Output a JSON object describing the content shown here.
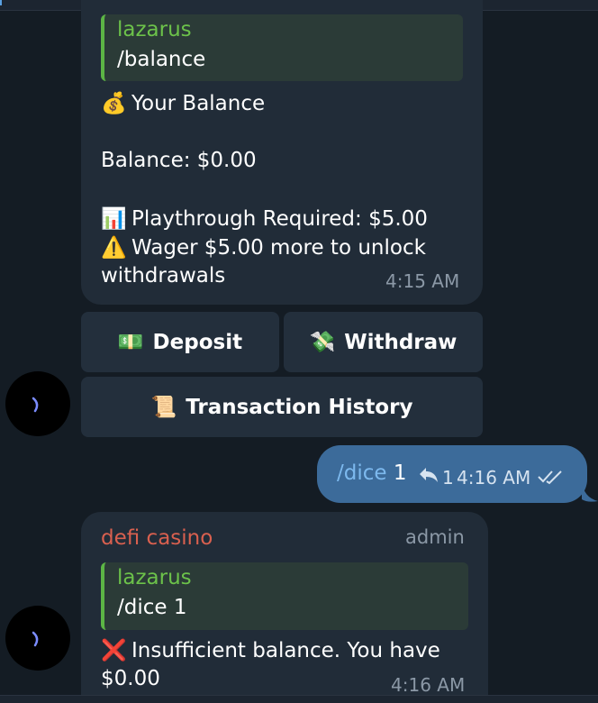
{
  "colors": {
    "background": "#141c24",
    "bubble_in": "#212c38",
    "bubble_out": "#3c6b9a",
    "reply_bar": "#5cb545",
    "sender_name": "#d9604f",
    "command_link": "#7db9ee"
  },
  "message1": {
    "reply": {
      "name": "lazarus",
      "text": "/balance"
    },
    "title_emoji": "💰",
    "title": "Your Balance",
    "balance_line": "Balance: $0.00",
    "playthrough_emoji": "📊",
    "playthrough": "Playthrough Required: $5.00",
    "warning_emoji": "⚠️",
    "warning": "Wager $5.00 more to unlock",
    "warning_cont": "withdrawals",
    "time": "4:15 AM"
  },
  "keyboard": {
    "deposit_icon": "💵",
    "deposit": "Deposit",
    "withdraw_icon": "💸",
    "withdraw": "Withdraw",
    "history_icon": "📜",
    "history": "Transaction History"
  },
  "outgoing": {
    "command": "/dice",
    "arg": "1",
    "replies_count": "1",
    "time": "4:16 AM",
    "status_icon": "double-check-icon"
  },
  "message2": {
    "sender": "defi casino",
    "role": "admin",
    "reply": {
      "name": "lazarus",
      "text": "/dice 1"
    },
    "error_emoji": "❌",
    "error": "Insufficient balance. You have",
    "error_cont": "$0.00",
    "time": "4:16 AM"
  }
}
